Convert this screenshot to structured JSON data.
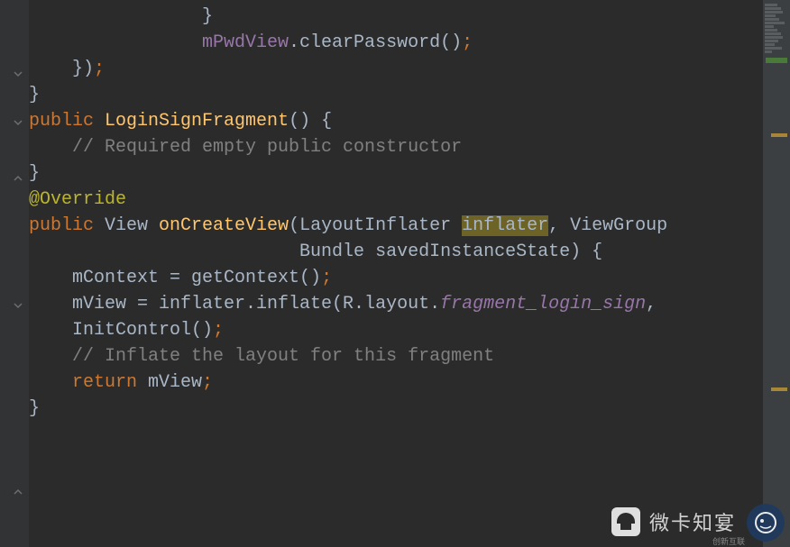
{
  "code": {
    "line1_brace": "                }",
    "line2_a": "                mPwdView",
    "line2_b": ".clearPassword()",
    "line2_semi": ";",
    "line3_a": "    }",
    "line3_b": ")",
    "line3_semi": ";",
    "line4": "}",
    "line5": "",
    "line6_a": "public",
    "line6_b": " ",
    "line6_c": "LoginSignFragment",
    "line6_d": "() {",
    "line7": "    // Required empty public constructor",
    "line8": "}",
    "line9": "",
    "line10": "",
    "line11": "@Override",
    "line12_a": "public",
    "line12_b": " View ",
    "line12_c": "onCreateView",
    "line12_d": "(LayoutInflater ",
    "line12_e": "inflater",
    "line12_f": ", ViewGroup",
    "line13": "                         Bundle savedInstanceState) {",
    "line14_a": "    mContext = getContext()",
    "line14_semi": ";",
    "line15_a": "    mView = inflater.inflate(R.layout.",
    "line15_b": "fragment_login_sign",
    "line15_c": ",",
    "line16": "",
    "line17_a": "    InitControl()",
    "line17_semi": ";",
    "line18": "    // Inflate the layout for this fragment",
    "line19_a": "    ",
    "line19_b": "return",
    "line19_c": " mView",
    "line19_semi": ";",
    "line20": "}"
  },
  "watermark": {
    "text": "微卡知宴"
  },
  "corner": {
    "label": "创新互联"
  }
}
